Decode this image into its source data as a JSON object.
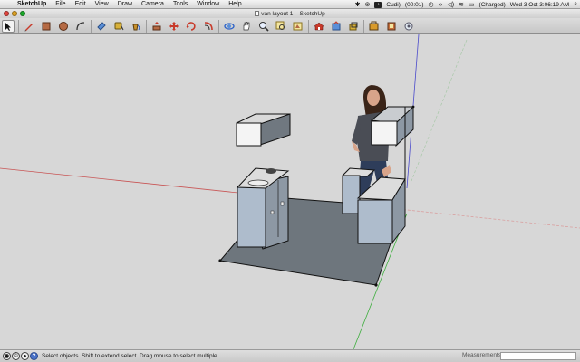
{
  "menubar": {
    "apple": "",
    "app_name": "SketchUp",
    "items": [
      "File",
      "Edit",
      "View",
      "Draw",
      "Camera",
      "Tools",
      "Window",
      "Help"
    ],
    "status": {
      "cudi": "Cudi)",
      "timer": "(00:01)",
      "battery": "(Charged)",
      "datetime": "Wed 3 Oct  3:06:19 AM"
    }
  },
  "window": {
    "title": "van layout 1 – SketchUp"
  },
  "toolbar": {
    "tools": [
      {
        "name": "select-tool",
        "icon": "arrow-icon",
        "active": true
      },
      {
        "name": "pencil-tool",
        "icon": "pencil-icon"
      },
      {
        "name": "rectangle-tool",
        "icon": "rectangle-icon"
      },
      {
        "name": "circle-tool",
        "icon": "circle-icon"
      },
      {
        "name": "arc-tool",
        "icon": "arc-icon"
      },
      {
        "name": "eraser-tool",
        "icon": "eraser-icon"
      },
      {
        "name": "tape-tool",
        "icon": "tape-measure-icon"
      },
      {
        "name": "paint-tool",
        "icon": "paint-bucket-icon"
      },
      {
        "name": "pushpull-tool",
        "icon": "push-pull-icon"
      },
      {
        "name": "move-tool",
        "icon": "move-icon"
      },
      {
        "name": "rotate-tool",
        "icon": "rotate-icon"
      },
      {
        "name": "offset-tool",
        "icon": "offset-icon"
      },
      {
        "name": "orbit-tool",
        "icon": "orbit-icon"
      },
      {
        "name": "pan-tool",
        "icon": "pan-hand-icon"
      },
      {
        "name": "zoom-tool",
        "icon": "zoom-icon"
      },
      {
        "name": "zoom-window-tool",
        "icon": "zoom-window-icon"
      },
      {
        "name": "zoom-extents-tool",
        "icon": "zoom-extents-icon"
      },
      {
        "name": "warehouse-tool",
        "icon": "warehouse-icon"
      },
      {
        "name": "share-model-tool",
        "icon": "share-model-icon"
      },
      {
        "name": "component-tool",
        "icon": "component-icon"
      },
      {
        "name": "extension-tool",
        "icon": "extension-icon"
      },
      {
        "name": "layout-tool",
        "icon": "layout-icon"
      },
      {
        "name": "settings-tool",
        "icon": "gear-icon"
      }
    ]
  },
  "statusbar": {
    "text": "Select objects. Shift to extend select. Drag mouse to select multiple.",
    "measurements_label": "Measurements",
    "measurements_value": ""
  },
  "colors": {
    "axis_red": "#c85454",
    "axis_green": "#3fae3f",
    "axis_blue": "#4a4acb",
    "floor": "#6e767d",
    "box_side": "#9aa8b8",
    "box_top": "#f2f4f6"
  }
}
